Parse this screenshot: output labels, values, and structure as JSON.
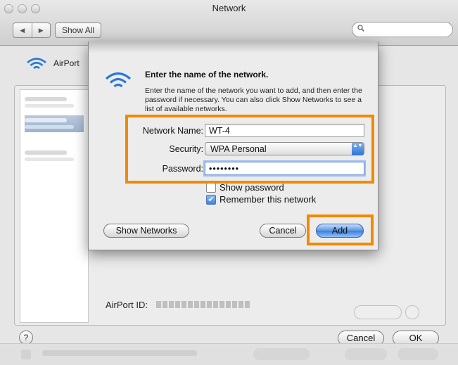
{
  "window": {
    "title": "Network",
    "show_all_label": "Show All",
    "search_placeholder": "",
    "back_glyph": "◀",
    "forward_glyph": "▶",
    "search_glyph": "🔍"
  },
  "background": {
    "location_label": "AirPort",
    "airport_id_label": "AirPort ID:",
    "help_label": "?",
    "cancel_label": "Cancel",
    "ok_label": "OK"
  },
  "dialog": {
    "heading": "Enter the name of the network.",
    "description": "Enter the name of the network you want to add, and then enter the password if necessary. You can also click Show Networks to see a list of available networks.",
    "network_name_label": "Network Name:",
    "network_name_value": "WT-4",
    "security_label": "Security:",
    "security_value": "WPA Personal",
    "password_label": "Password:",
    "password_value": "••••••••",
    "show_password_label": "Show password",
    "show_password_checked": false,
    "remember_label": "Remember this network",
    "remember_checked": true,
    "checkmark_glyph": "✔",
    "popup_arrows_glyph": "▲▼",
    "show_networks_label": "Show Networks",
    "cancel_label": "Cancel",
    "add_label": "Add"
  },
  "colors": {
    "highlight": "#f08a00",
    "accent_blue": "#3a7ddc",
    "wifi_blue": "#2a78d8"
  }
}
